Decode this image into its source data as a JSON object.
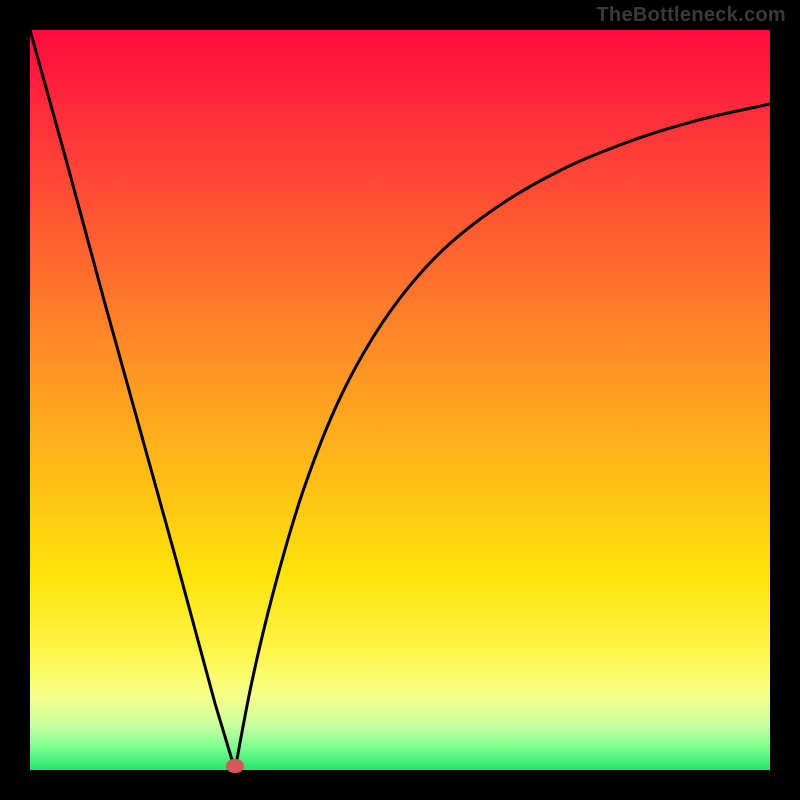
{
  "watermark": "TheBottleneck.com",
  "chart_data": {
    "type": "line",
    "title": "",
    "xlabel": "",
    "ylabel": "",
    "xlim": [
      0,
      1
    ],
    "ylim": [
      0,
      1
    ],
    "grid": false,
    "legend": false,
    "series": [
      {
        "name": "left-branch",
        "x": [
          0.0,
          0.05,
          0.1,
          0.15,
          0.2,
          0.25,
          0.277
        ],
        "y": [
          1.0,
          0.82,
          0.635,
          0.455,
          0.275,
          0.09,
          0.0
        ]
      },
      {
        "name": "right-branch",
        "x": [
          0.277,
          0.3,
          0.33,
          0.37,
          0.42,
          0.48,
          0.55,
          0.63,
          0.72,
          0.82,
          0.91,
          1.0
        ],
        "y": [
          0.0,
          0.12,
          0.245,
          0.38,
          0.505,
          0.61,
          0.695,
          0.76,
          0.812,
          0.853,
          0.88,
          0.9
        ]
      }
    ],
    "minimum": {
      "x": 0.277,
      "y": 0.0
    },
    "colors": {
      "curve": "#000000",
      "minimum_marker": "#d25a5a",
      "gradient_top": "#ff0a3e",
      "gradient_bottom": "#25e46e"
    }
  }
}
